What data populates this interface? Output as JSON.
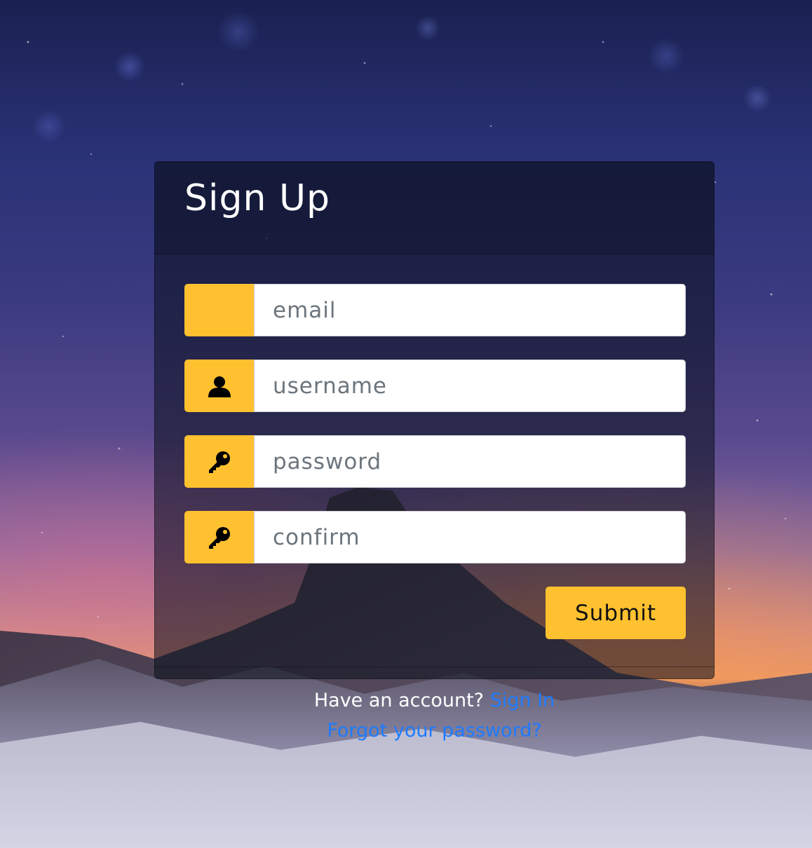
{
  "form": {
    "title": "Sign Up",
    "fields": [
      {
        "placeholder": "email",
        "icon": "envelope-icon"
      },
      {
        "placeholder": "username",
        "icon": "user-icon"
      },
      {
        "placeholder": "password",
        "icon": "key-icon"
      },
      {
        "placeholder": "confirm",
        "icon": "key-icon"
      }
    ],
    "submit_label": "Submit"
  },
  "links": {
    "have_account_text": "Have an account?",
    "sign_in_label": "Sign In",
    "forgot_password_label": "Forgot your password?"
  },
  "colors": {
    "accent": "#ffc12f",
    "link": "#1e7bff"
  }
}
